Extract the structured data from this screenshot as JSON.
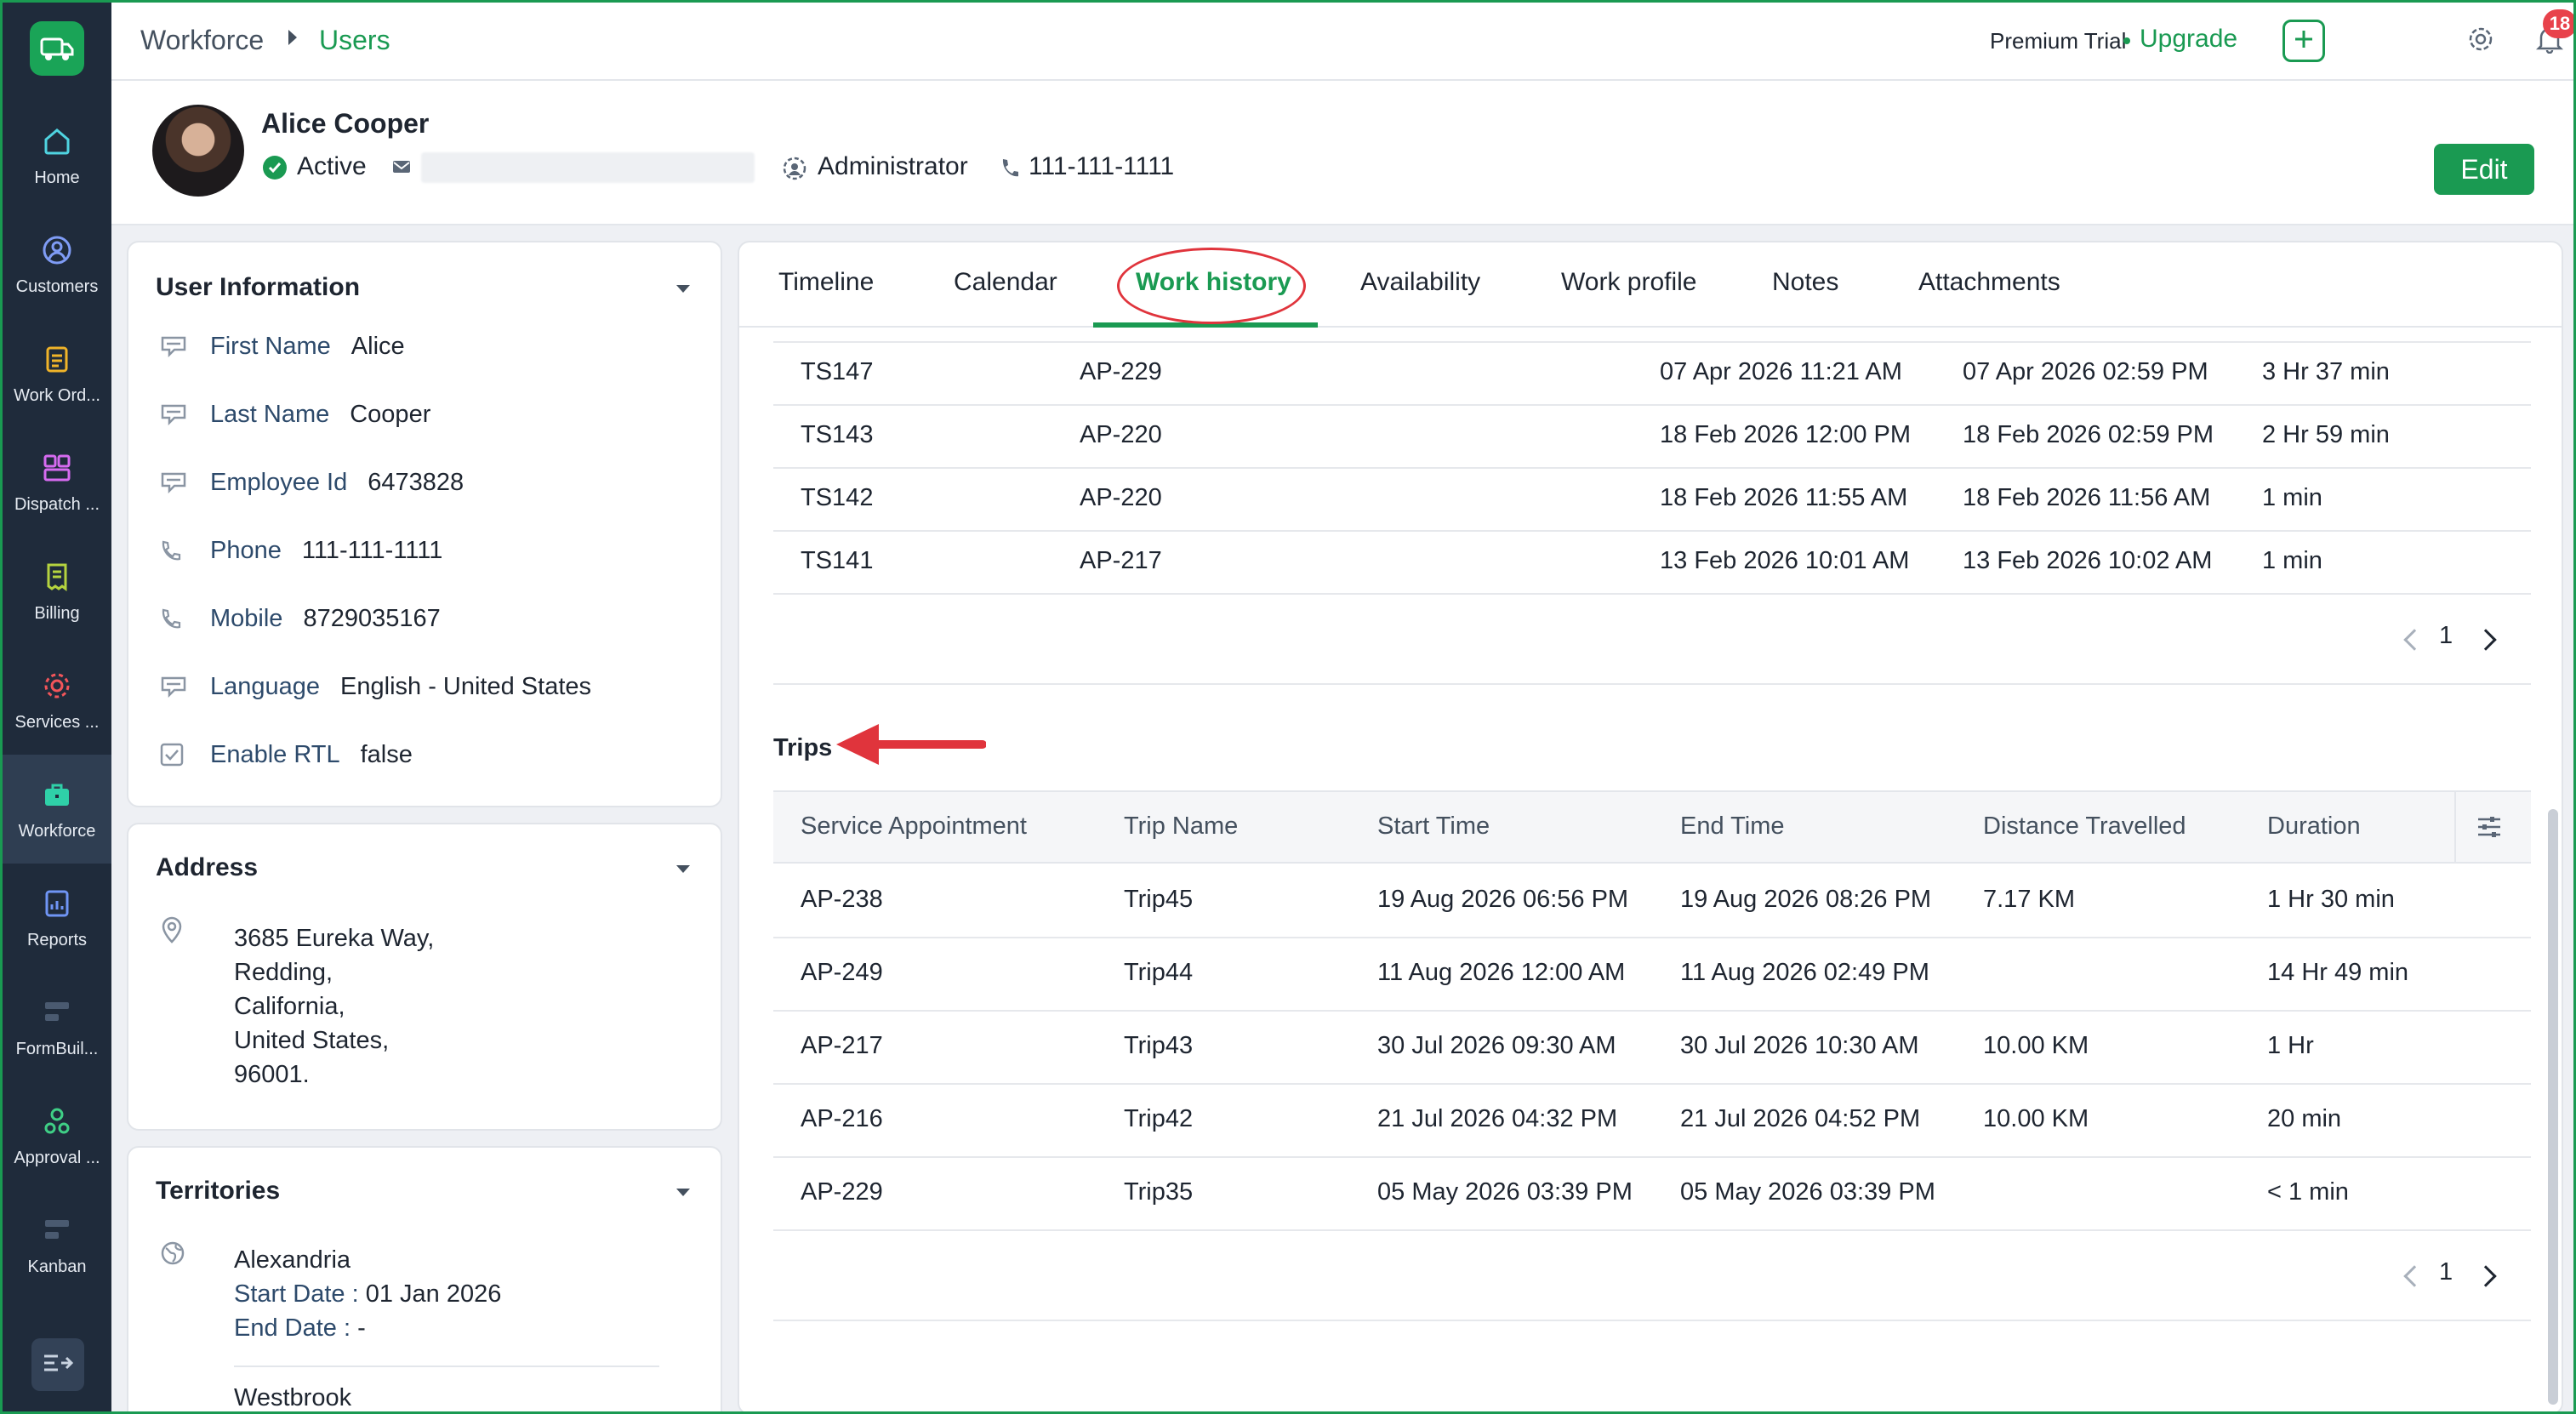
{
  "nav": {
    "items": [
      {
        "label": "Home",
        "icon": "home-icon"
      },
      {
        "label": "Customers",
        "icon": "customers-icon"
      },
      {
        "label": "Work Ord...",
        "icon": "work-orders-icon"
      },
      {
        "label": "Dispatch ...",
        "icon": "dispatch-icon"
      },
      {
        "label": "Billing",
        "icon": "billing-icon"
      },
      {
        "label": "Services ...",
        "icon": "services-icon"
      },
      {
        "label": "Workforce",
        "icon": "workforce-icon"
      },
      {
        "label": "Reports",
        "icon": "reports-icon"
      },
      {
        "label": "FormBuil...",
        "icon": "formbuilder-icon"
      },
      {
        "label": "Approval ...",
        "icon": "approval-icon"
      },
      {
        "label": "Kanban",
        "icon": "kanban-icon"
      }
    ],
    "active": "Workforce"
  },
  "topbar": {
    "breadcrumb_root": "Workforce",
    "breadcrumb_current": "Users",
    "trial_label": "Premium Trial",
    "upgrade_label": "Upgrade",
    "notification_count": "18"
  },
  "profile": {
    "name": "Alice Cooper",
    "status": "Active",
    "role": "Administrator",
    "phone": "111-111-1111",
    "edit_label": "Edit"
  },
  "user_info": {
    "title": "User Information",
    "fields": [
      {
        "label": "First Name",
        "value": "Alice"
      },
      {
        "label": "Last Name",
        "value": "Cooper"
      },
      {
        "label": "Employee Id",
        "value": "6473828"
      },
      {
        "label": "Phone",
        "value": "111-111-1111"
      },
      {
        "label": "Mobile",
        "value": "8729035167"
      },
      {
        "label": "Language",
        "value": "English - United States"
      },
      {
        "label": "Enable RTL",
        "value": "false"
      }
    ]
  },
  "address": {
    "title": "Address",
    "lines": [
      "3685 Eureka Way,",
      "Redding,",
      "California,",
      "United States,",
      "96001."
    ]
  },
  "territories": {
    "title": "Territories",
    "items": [
      {
        "name": "Alexandria",
        "start_label": "Start Date :",
        "start_value": "01 Jan 2026",
        "end_label": "End Date :",
        "end_value": "-"
      },
      {
        "name": "Westbrook"
      }
    ]
  },
  "tabs": [
    "Timeline",
    "Calendar",
    "Work history",
    "Availability",
    "Work profile",
    "Notes",
    "Attachments"
  ],
  "active_tab": "Work history",
  "timesheets": {
    "rows": [
      [
        "TS147",
        "AP-229",
        "07 Apr 2026 11:21 AM",
        "07 Apr 2026 02:59 PM",
        "3 Hr 37 min"
      ],
      [
        "TS143",
        "AP-220",
        "18 Feb 2026 12:00 PM",
        "18 Feb 2026 02:59 PM",
        "2 Hr 59 min"
      ],
      [
        "TS142",
        "AP-220",
        "18 Feb 2026 11:55 AM",
        "18 Feb 2026 11:56 AM",
        "1 min"
      ],
      [
        "TS141",
        "AP-217",
        "13 Feb 2026 10:01 AM",
        "13 Feb 2026 10:02 AM",
        "1 min"
      ]
    ],
    "page": "1"
  },
  "trips": {
    "title": "Trips",
    "columns": [
      "Service Appointment",
      "Trip Name",
      "Start Time",
      "End Time",
      "Distance Travelled",
      "Duration"
    ],
    "rows": [
      [
        "AP-238",
        "Trip45",
        "19 Aug 2026 06:56 PM",
        "19 Aug 2026 08:26 PM",
        "7.17 KM",
        "1 Hr 30 min"
      ],
      [
        "AP-249",
        "Trip44",
        "11 Aug 2026 12:00 AM",
        "11 Aug 2026 02:49 PM",
        "",
        "14 Hr 49 min"
      ],
      [
        "AP-217",
        "Trip43",
        "30 Jul 2026 09:30 AM",
        "30 Jul 2026 10:30 AM",
        "10.00 KM",
        "1 Hr"
      ],
      [
        "AP-216",
        "Trip42",
        "21 Jul 2026 04:32 PM",
        "21 Jul 2026 04:52 PM",
        "10.00 KM",
        "20 min"
      ],
      [
        "AP-229",
        "Trip35",
        "05 May 2026 03:39 PM",
        "05 May 2026 03:39 PM",
        "",
        "< 1 min"
      ]
    ],
    "page": "1"
  },
  "colors": {
    "brand_green": "#1a9a52",
    "rail_bg": "#1f2b3b",
    "annotation_red": "#e0343c"
  }
}
